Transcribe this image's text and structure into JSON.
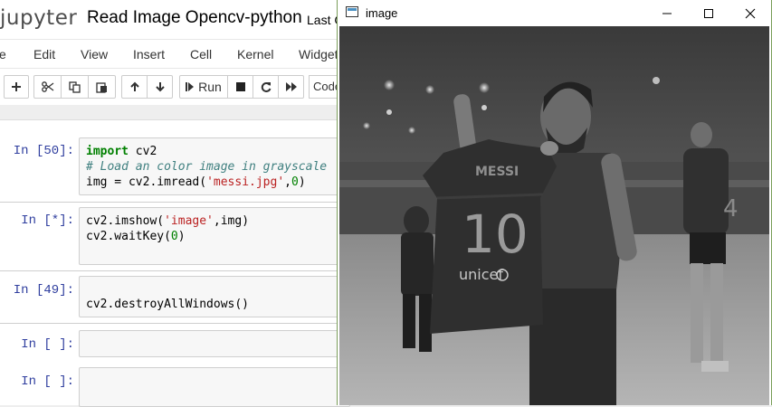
{
  "jupyter": {
    "logo": "jupyter",
    "notebook_title": "Read Image Opencv-python",
    "checkpoint": "Last C",
    "menu": [
      "e",
      "Edit",
      "View",
      "Insert",
      "Cell",
      "Kernel",
      "Widgets"
    ],
    "toolbar": {
      "run_label": "Run",
      "cell_type": "Code"
    },
    "cells": [
      {
        "prompt": "In [50]:",
        "lines": [
          "import cv2",
          "# Load an color image in grayscale",
          "img = cv2.imread('messi.jpg',0)"
        ]
      },
      {
        "prompt": "In [*]:",
        "lines": [
          "cv2.imshow('image',img)",
          "cv2.waitKey(0)"
        ]
      },
      {
        "prompt": "In [49]:",
        "lines": [
          "cv2.destroyAllWindows()"
        ]
      },
      {
        "prompt": "In [ ]:",
        "lines": []
      },
      {
        "prompt": "In [ ]:",
        "lines": []
      }
    ],
    "code_tokens": {
      "c1_kw": "import",
      "c1_mod": " cv2",
      "c1_comment": "# Load an color image in grayscale",
      "c1_l3a": "img = cv2.imread(",
      "c1_l3s": "'messi.jpg'",
      "c1_l3b": ",",
      "c1_l3n": "0",
      "c1_l3c": ")",
      "c2_l1a": "cv2.imshow(",
      "c2_l1s": "'image'",
      "c2_l1b": ",img)",
      "c2_l2a": "cv2.waitKey(",
      "c2_l2n": "0",
      "c2_l2b": ")",
      "c3_l1": "cv2.destroyAllWindows()"
    }
  },
  "image_window": {
    "title": "image",
    "buttons": [
      "minimize",
      "maximize",
      "close"
    ],
    "photo": {
      "description_shown": false,
      "jersey_name": "MESSI",
      "jersey_number": "10",
      "sponsor": "unicef",
      "back_number": "4"
    }
  },
  "colors": {
    "prompt": "#303f9f",
    "keyword": "#008000",
    "comment": "#408080",
    "string": "#ba2121",
    "window_border": "#7a9e5a"
  }
}
